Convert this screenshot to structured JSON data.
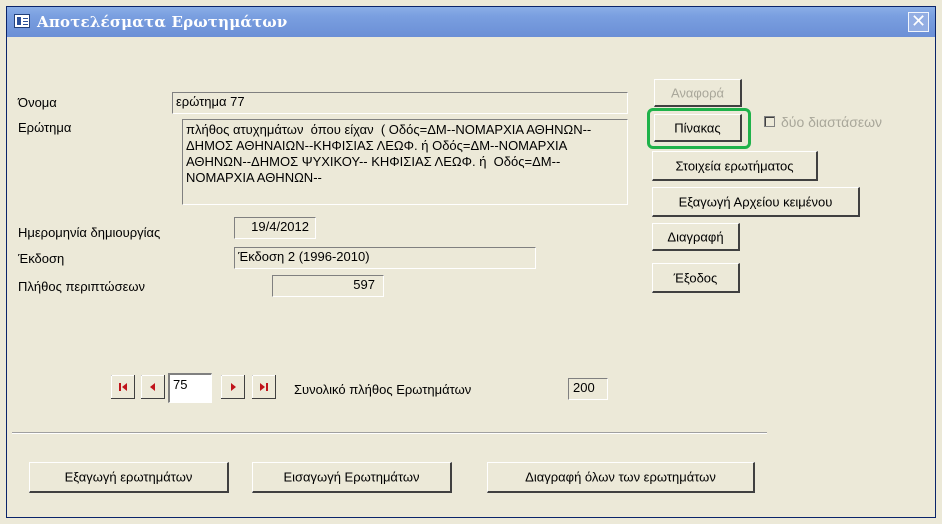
{
  "window": {
    "title": "Αποτελέσματα Ερωτημάτων",
    "close_symbol": "✕"
  },
  "form": {
    "name_label": "Όνομα",
    "name_value": "ερώτημα 77",
    "query_label": "Ερώτημα",
    "query_value": "πλήθος ατυχημάτων  όπου είχαν  ( Οδός=ΔΜ--ΝΟΜΑΡΧΙΑ ΑΘΗΝΩΝ--ΔΗΜΟΣ ΑΘΗΝΑΙΩΝ--ΚΗΦΙΣΙΑΣ ΛΕΩΦ. ή Οδός=ΔΜ--ΝΟΜΑΡΧΙΑ ΑΘΗΝΩΝ--ΔΗΜΟΣ ΨΥΧΙΚΟΥ-- ΚΗΦΙΣΙΑΣ ΛΕΩΦ. ή  Οδός=ΔΜ--ΝΟΜΑΡΧΙΑ ΑΘΗΝΩΝ--",
    "date_label": "Ημερομηνία δημιουργίας",
    "date_value": "19/4/2012",
    "edition_label": "Έκδοση",
    "edition_value": "Έκδοση 2 (1996-2010)",
    "cases_label": "Πλήθος περιπτώσεων",
    "cases_value": "597"
  },
  "side_buttons": {
    "report": "Αναφορά",
    "table": "Πίνακας",
    "two_dim_label": "δύο διαστάσεων",
    "query_info": "Στοιχεία ερωτήματος",
    "export_text": "Εξαγωγή Αρχείου κειμένου",
    "delete": "Διαγραφή",
    "exit": "Έξοδος"
  },
  "navigation": {
    "current_record": "75",
    "total_label": "Συνολικό πλήθος Ερωτημάτων",
    "total_value": "200"
  },
  "bottom_buttons": {
    "export": "Εξαγωγή ερωτημάτων",
    "import": "Εισαγωγή Ερωτημάτων",
    "delete_all": "Διαγραφή όλων των ερωτημάτων"
  },
  "colors": {
    "nav_arrow": "#c0141b",
    "highlight": "#1fb24a",
    "title_bar": "#7a9fe0"
  },
  "icons": {
    "first": "first-record-icon",
    "prev": "previous-record-icon",
    "next": "next-record-icon",
    "last": "last-record-icon"
  }
}
